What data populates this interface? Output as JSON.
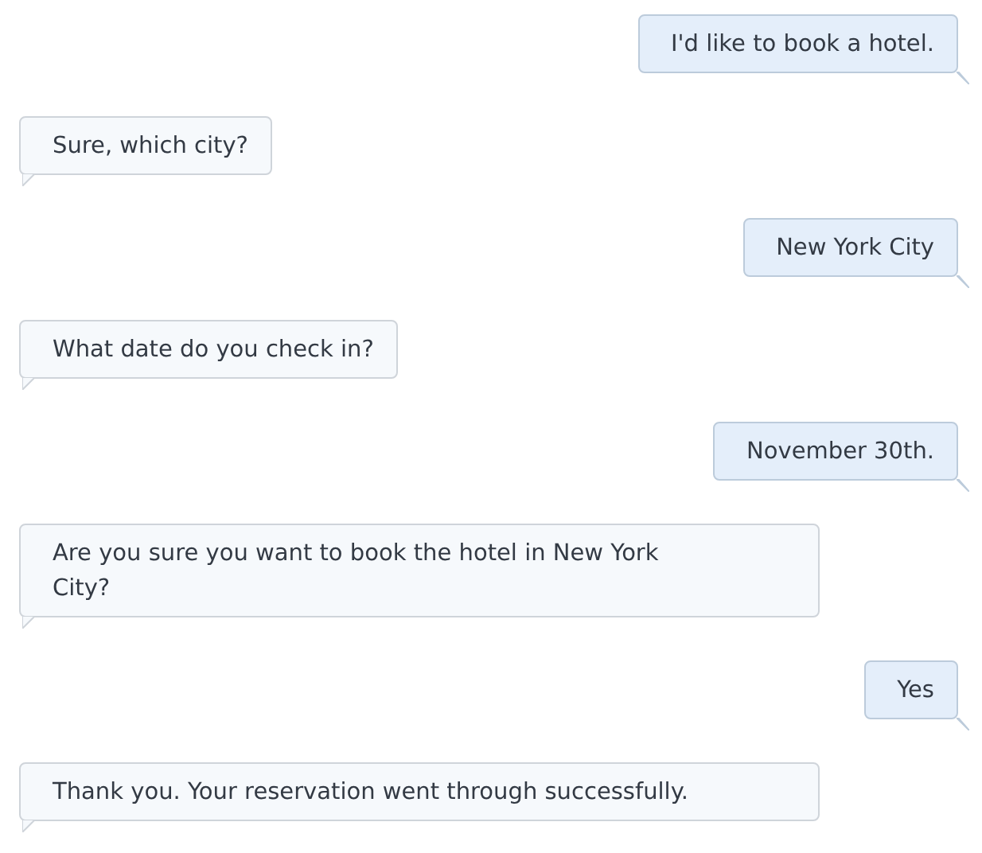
{
  "messages": [
    {
      "kind": "user",
      "text": "I'd like to book a hotel."
    },
    {
      "kind": "bot",
      "text": "Sure, which city?"
    },
    {
      "kind": "user",
      "text": "New York City"
    },
    {
      "kind": "bot",
      "text": "What date do you check in?"
    },
    {
      "kind": "user",
      "text": "November 30th."
    },
    {
      "kind": "bot",
      "text": "Are you sure you want to book the hotel in New York City?"
    },
    {
      "kind": "user",
      "text": "Yes"
    },
    {
      "kind": "bot",
      "text": "Thank you. Your reservation went through successfully."
    }
  ]
}
